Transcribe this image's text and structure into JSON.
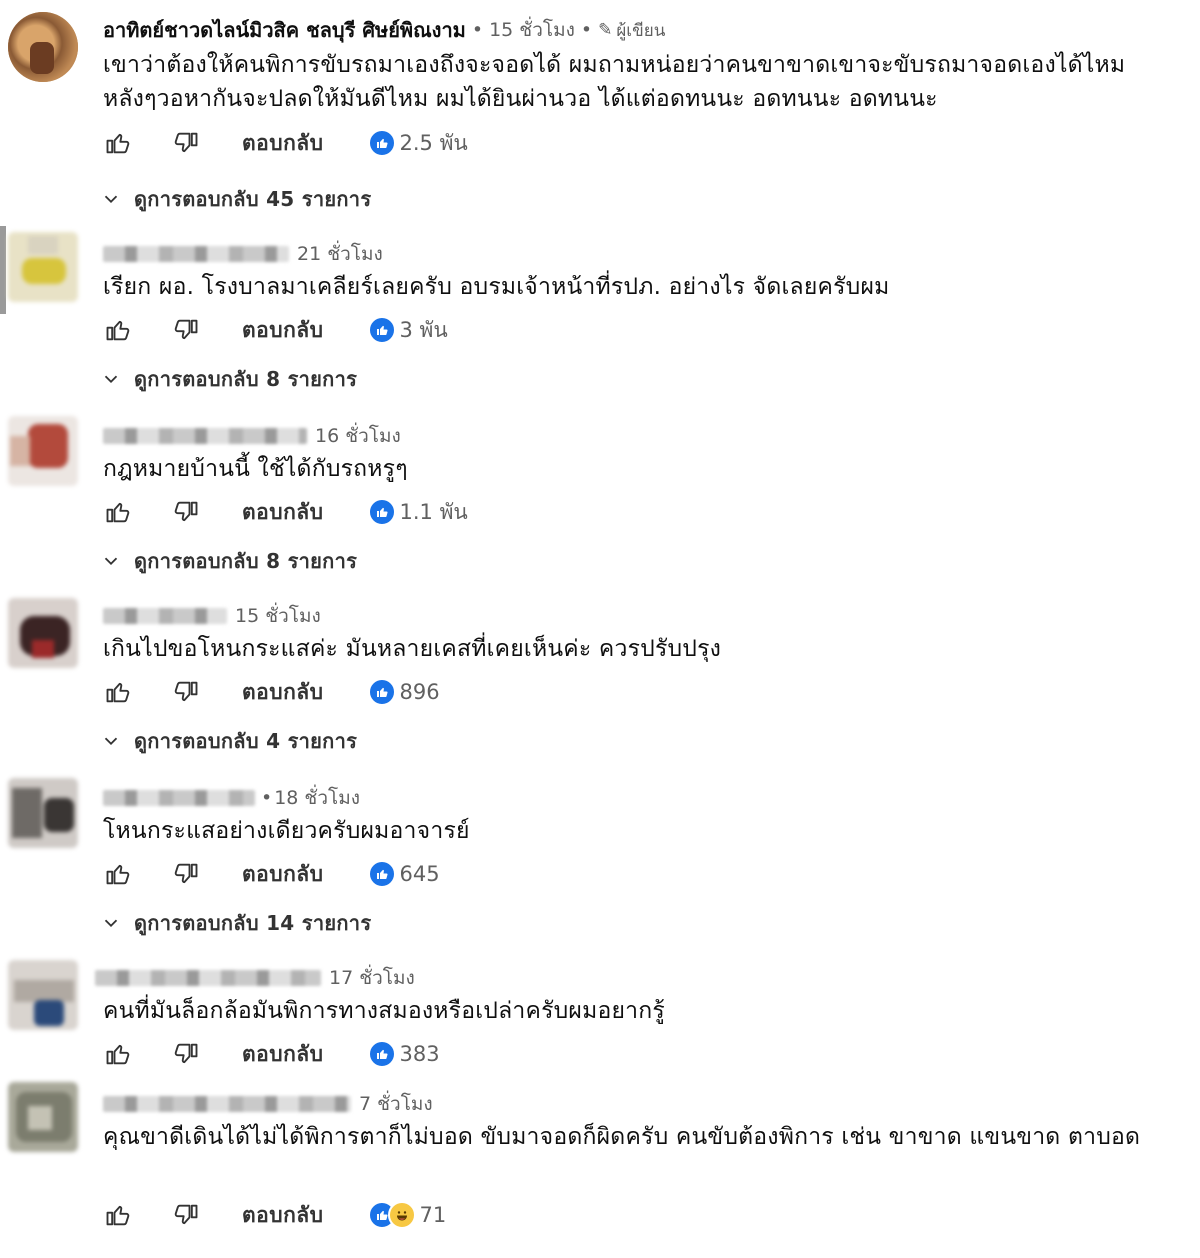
{
  "reply_label": "ตอบกลับ",
  "comments": [
    {
      "author": "อาทิตย์ชาวดไลน์มิวสิค ชลบุรี ศิษย์พิณงาม",
      "time": "15 ชั่วโมง",
      "creator_badge": "ผู้เขียน",
      "text": "เขาว่าต้องให้คนพิการขับรถมาเองถึงจะจอดได้ ผมถามหน่อยว่าคนขาขาดเขาจะขับรถมาจอดเองได้ไหม หลังๆวอหากันจะปลดให้มันดีไหม ผมได้ยินผ่านวอ ได้แต่อดทนนะ อดทนนะ อดทนนะ",
      "likes": "2.5 พัน",
      "replies": "ดูการตอบกลับ 45 รายการ"
    },
    {
      "time": "21 ชั่วโมง",
      "text": "เรียก ผอ. โรงบาลมาเคลียร์เลยครับ อบรมเจ้าหน้าที่รปภ. อย่างไร จัดเลยครับผม",
      "likes": "3 พัน",
      "replies": "ดูการตอบกลับ 8 รายการ"
    },
    {
      "time": "16 ชั่วโมง",
      "text": "กฎหมายบ้านนี้ ใช้ได้กับรถหรูๆ",
      "likes": "1.1 พัน",
      "replies": "ดูการตอบกลับ 8 รายการ"
    },
    {
      "time": "15 ชั่วโมง",
      "text": "เกินไปขอโหนกระแสค่ะ มันหลายเคสที่เคยเห็นค่ะ ควรปรับปรุง",
      "likes": "896",
      "replies": "ดูการตอบกลับ 4 รายการ"
    },
    {
      "time": "18 ชั่วโมง",
      "text": "โหนกระแสอย่างเดียวครับผมอาจารย์",
      "likes": "645",
      "replies": "ดูการตอบกลับ 14 รายการ"
    },
    {
      "time": "17 ชั่วโมง",
      "text": "คนที่มันล็อกล้อมันพิการทางสมองหรือเปล่าครับผมอยากรู้",
      "likes": "383"
    },
    {
      "time": "7 ชั่วโมง",
      "text": "คุณขาดีเดินได้ไม่ได้พิการตาก็ไม่บอด ขับมาจอดก็ผิดครับ คนขับต้องพิการ เช่น ขาขาด แขนขาด ตาบอด",
      "likes": "71"
    }
  ],
  "colors": {
    "reaction_blue": "#1a73e8",
    "reaction_laugh": "#f7c843",
    "meta_gray": "#606060"
  },
  "icons": {
    "like": "thumbs-up-outline-icon",
    "dislike": "thumbs-down-outline-icon",
    "reaction": "like-reaction-icon",
    "laugh": "laugh-reaction-icon",
    "expand": "chevron-down-icon",
    "creator": "pencil-icon"
  }
}
